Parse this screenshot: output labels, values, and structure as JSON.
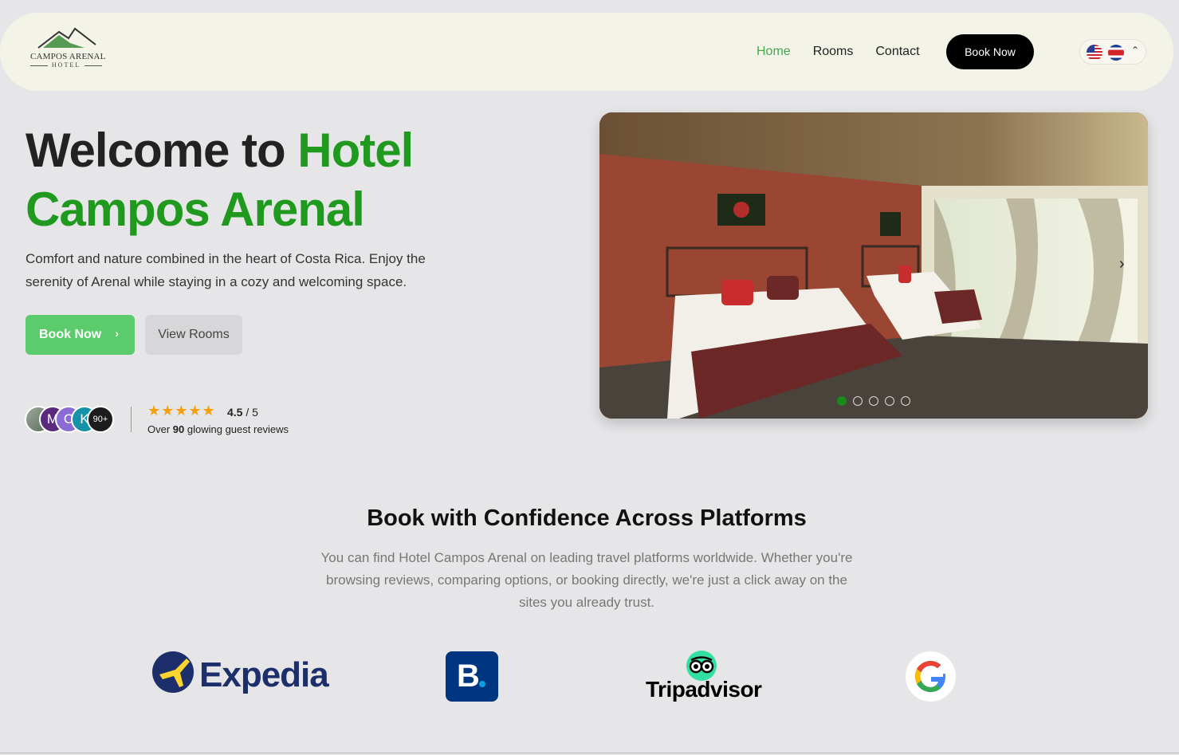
{
  "nav": {
    "logo_name": "CAMPOS ARENAL",
    "logo_sub": "HOTEL",
    "links": [
      "Home",
      "Rooms",
      "Contact"
    ],
    "active_link": "Home",
    "book_button": "Book Now",
    "languages": [
      "us-flag-icon",
      "cr-flag-icon"
    ]
  },
  "hero": {
    "title_dark": "Welcome to ",
    "title_green_1": "Hotel",
    "title_green_2": "Campos Arenal",
    "description": "Comfort and nature combined in the heart of Costa Rica. Enjoy the serenity of Arenal while staying in a cozy and welcoming space.",
    "book_button": "Book Now",
    "rooms_button": "View Rooms",
    "avatars": [
      "",
      "M",
      "C",
      "K",
      "90+"
    ],
    "stars": "★★★★★",
    "rating_value": "4.5",
    "rating_scale": " / 5",
    "reviews_prefix": "Over ",
    "reviews_count": "90",
    "reviews_suffix": " glowing guest reviews"
  },
  "slider": {
    "dots": 5,
    "active_dot": 0
  },
  "platforms": {
    "title": "Book with Confidence Across Platforms",
    "description": "You can find Hotel Campos Arenal on leading travel platforms worldwide. Whether you're browsing reviews, comparing options, or booking directly, we're just a click away on the sites you already trust.",
    "logos": {
      "expedia": "Expedia",
      "booking": "B",
      "tripadvisor": "Tripadvisor"
    }
  },
  "colors": {
    "accent_green": "#1f9a1f",
    "button_green": "#5ccb6b",
    "nav_bg": "#f3f3e8",
    "page_bg": "#e6e6e8"
  }
}
